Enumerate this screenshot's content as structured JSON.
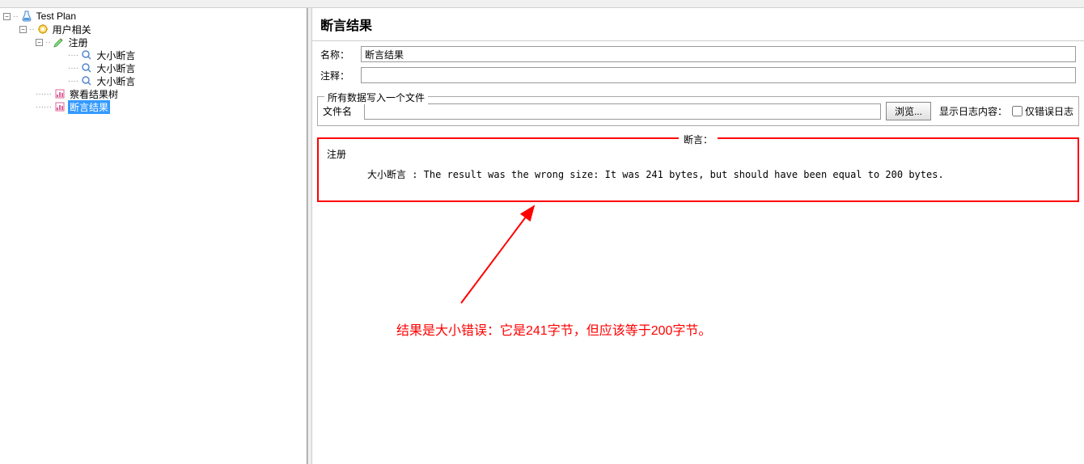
{
  "tree": {
    "root": "Test Plan",
    "userRelated": "用户相关",
    "register": "注册",
    "sizeAssertion1": "大小断言",
    "sizeAssertion2": "大小断言",
    "sizeAssertion3": "大小断言",
    "viewResultsTree": "察看结果树",
    "assertionResults": "断言结果"
  },
  "panel": {
    "title": "断言结果",
    "nameLabel": "名称：",
    "nameValue": "断言结果",
    "commentLabel": "注释：",
    "commentValue": ""
  },
  "fileSection": {
    "legend": "所有数据写入一个文件",
    "fileLabel": "文件名",
    "fileValue": "",
    "browseBtn": "浏览...",
    "logLabel": "显示日志内容：",
    "errorOnlyLabel": "仅错误日志"
  },
  "assertion": {
    "legend": "断言：",
    "regLabel": "注册",
    "message": "大小断言 : The result was the wrong size: It was 241 bytes, but should have been equal to 200 bytes."
  },
  "annotation": {
    "text": "结果是大小错误：它是241字节，但应该等于200字节。"
  }
}
